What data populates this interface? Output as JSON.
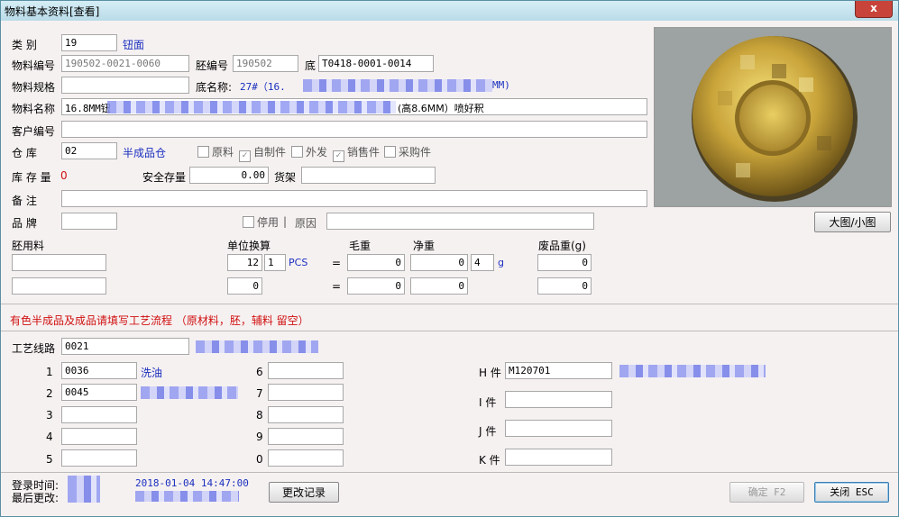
{
  "window": {
    "title": "物料基本资料[查看]",
    "close": "x"
  },
  "fields": {
    "category_label": "类   别",
    "category_value": "19",
    "category_name": "钮面",
    "code_label": "物料编号",
    "code_value": "190502-0021-0060",
    "blank_no_label": "胚编号",
    "blank_no_value": "190502",
    "base_label": "底",
    "base_value": "T0418-0001-0014",
    "spec_label": "物料规格",
    "spec_value": "",
    "base_name_label": "底名称:",
    "base_name_value": "27#（16.",
    "base_name_tail": "MM)",
    "name_label": "物料名称",
    "name_value_start": "16.8MM钮",
    "name_value_end": "(高8.6MM）喷好釈",
    "customer_label": "客户编号",
    "customer_value": "",
    "warehouse_label": "仓   库",
    "warehouse_value": "02",
    "warehouse_name": "半成品仓",
    "stock_label": "库 存 量",
    "stock_value": "0",
    "safety_label": "安全存量",
    "safety_value": "0.00",
    "shelf_label": "货架",
    "shelf_value": "",
    "remark_label": "备   注",
    "remark_value": "",
    "brand_label": "品   牌",
    "brand_value": ""
  },
  "checkboxes": [
    {
      "label": "原料",
      "checked": false
    },
    {
      "label": "自制件",
      "checked": true
    },
    {
      "label": "外发",
      "checked": false
    },
    {
      "label": "销售件",
      "checked": true
    },
    {
      "label": "采购件",
      "checked": false
    }
  ],
  "disable": {
    "label": "停用",
    "reason_label": "原因",
    "reason_value": ""
  },
  "image_toggle": "大图/小图",
  "weights": {
    "blank_material": "胚用料",
    "unit_conv": "单位换算",
    "gross": "毛重",
    "net": "净重",
    "scrap": "废品重(g)",
    "row1": {
      "conv_a": "12",
      "conv_b": "1",
      "unit": "PCS",
      "eq": "=",
      "gross": "0",
      "net": "0",
      "net_count": "4",
      "g": "g",
      "scrap": "0"
    },
    "row2": {
      "conv": "0",
      "eq": "=",
      "gross": "0",
      "net": "0",
      "scrap": "0"
    }
  },
  "notice": "有色半成品及成品请填写工艺流程  （原材料，胚，辅料 留空）",
  "process": {
    "route_label": "工艺线路",
    "route_value": "0021",
    "steps_left": [
      {
        "n": "1",
        "code": "0036",
        "name": "洗油"
      },
      {
        "n": "2",
        "code": "0045",
        "name": ""
      },
      {
        "n": "3",
        "code": "",
        "name": ""
      },
      {
        "n": "4",
        "code": "",
        "name": ""
      },
      {
        "n": "5",
        "code": "",
        "name": ""
      }
    ],
    "steps_mid": [
      {
        "n": "6",
        "code": ""
      },
      {
        "n": "7",
        "code": ""
      },
      {
        "n": "8",
        "code": ""
      },
      {
        "n": "9",
        "code": ""
      },
      {
        "n": "0",
        "code": ""
      }
    ],
    "parts": [
      {
        "label": "H 件",
        "value": "M120701"
      },
      {
        "label": "I 件",
        "value": ""
      },
      {
        "label": "J 件",
        "value": ""
      },
      {
        "label": "K 件",
        "value": ""
      }
    ]
  },
  "footer": {
    "login_label": "登录时间:",
    "last_label": "最后更改:",
    "timestamp": "2018-01-04 14:47:00",
    "history_btn": "更改记录",
    "ok_btn": "确定 F2",
    "close_btn": "关闭 ESC"
  }
}
